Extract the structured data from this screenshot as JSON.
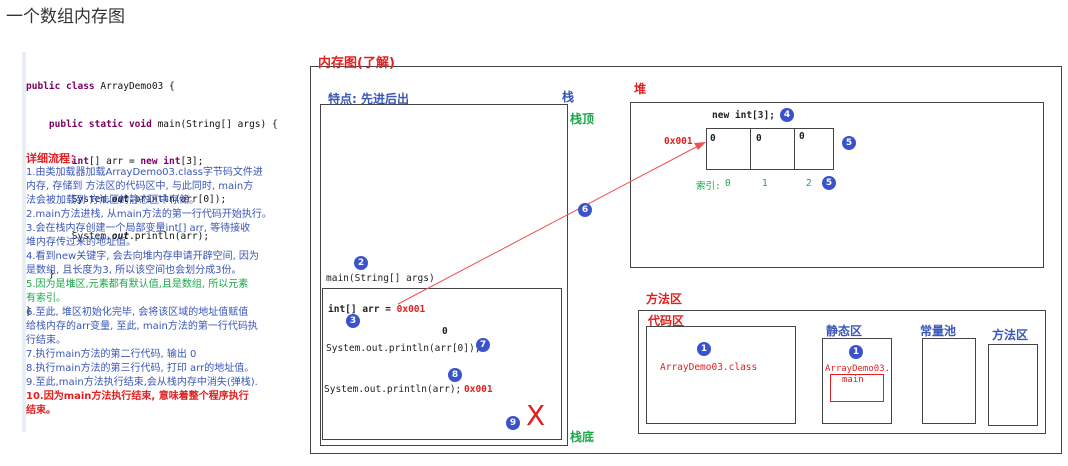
{
  "page_heading": "一个数组内存图",
  "code_lines": [
    "public class ArrayDemo03 {",
    "    public static void main(String[] args) {",
    "        int[] arr = new int[3];",
    "        System.out.println(arr[0]);",
    "        System.out.println(arr);",
    "    }",
    "}"
  ],
  "detail": {
    "title": "详细流程：",
    "lines": [
      "1.由类加载器加载ArrayDemo03.class字节码文件进",
      "内存, 存储到 方法区的代码区中, 与此同时, main方",
      "法会被加载到 方法区的静态区中存储。",
      "2.main方法进栈, 从main方法的第一行代码开始执行。",
      "3.会在栈内存创建一个局部变量int[] arr, 等待接收",
      "堆内存传过来的地址值。",
      "4.看到new关键字, 会去向堆内存申请开辟空间, 因为",
      "是数组, 且长度为3, 所以该空间也会划分成3份。",
      "5.因为是堆区,元素都有默认值,且是数组, 所以元素",
      "有索引。",
      "6.至此, 堆区初始化完毕, 会将该区域的地址值赋值",
      "给栈内存的arr变量, 至此, main方法的第一行代码执",
      "行结束。",
      "7.执行main方法的第二行代码, 输出 0",
      "8.执行main方法的第三行代码, 打印 arr的地址值。",
      "9.至此,main方法执行结束,会从栈内存中消失(弹栈).",
      "10.因为main方法执行结束, 意味着整个程序执行",
      "结束。"
    ]
  },
  "diagram": {
    "title": "内存图(了解)",
    "stack_feature": "特点: 先进后出",
    "stack_label": "栈",
    "stack_top": "栈顶",
    "stack_bottom": "栈底",
    "heap_label": "堆",
    "method_area_label": "方法区",
    "main_frame": "main(String[] args)",
    "stmt_decl_prefix": "int[] arr = ",
    "stmt_decl_addr": "0x001",
    "print_value": "0",
    "stmt_print1": "System.out.println(arr[0]);",
    "stmt_print2": "System.out.println(arr);",
    "print2_addr": "0x001",
    "new_expr": "new int[3];",
    "heap_address": "0x001",
    "array_values": [
      "0",
      "0",
      "0"
    ],
    "index_label": "索引:",
    "indices": [
      "0",
      "1",
      "2"
    ],
    "code_area_label": "代码区",
    "code_area_class": "ArrayDemo03.class",
    "static_area_label": "静态区",
    "static_class": "ArrayDemo03.",
    "static_main": "main",
    "const_pool_label": "常量池",
    "method_sub_label": "方法区",
    "close_mark": "X"
  },
  "badges": [
    "1",
    "1",
    "2",
    "3",
    "4",
    "5",
    "5",
    "6",
    "7",
    "8",
    "9"
  ]
}
